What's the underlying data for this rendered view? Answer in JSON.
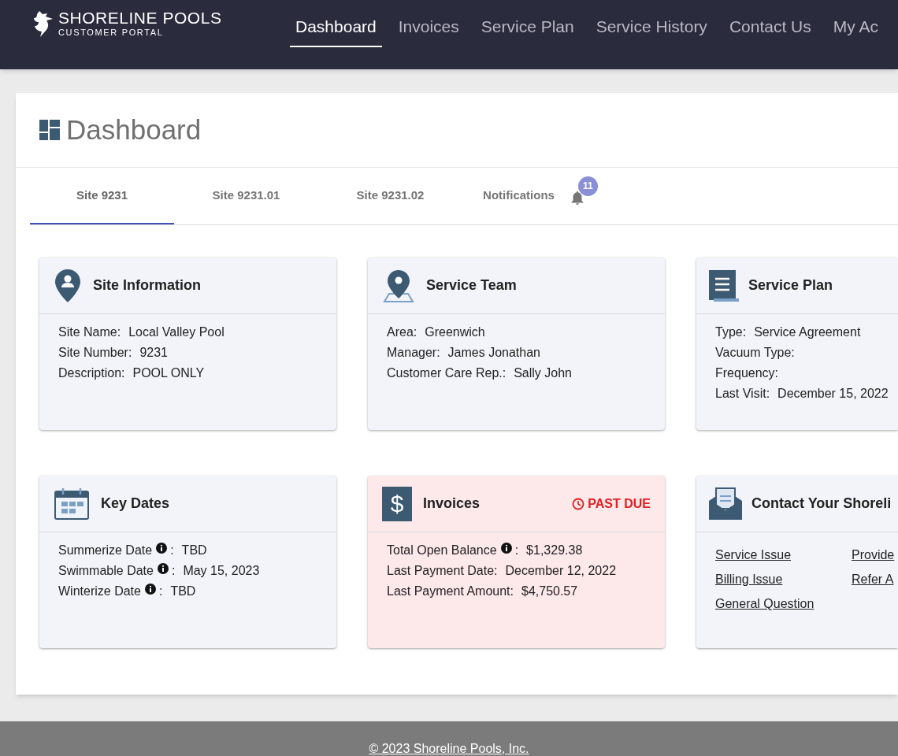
{
  "nav": {
    "logo": {
      "title": "SHORELINE POOLS",
      "subtitle": "CUSTOMER PORTAL"
    },
    "links": [
      {
        "label": "Dashboard",
        "selected": true
      },
      {
        "label": "Invoices",
        "selected": false
      },
      {
        "label": "Service Plan",
        "selected": false
      },
      {
        "label": "Service History",
        "selected": false
      },
      {
        "label": "Contact Us",
        "selected": false
      },
      {
        "label": "My Ac",
        "selected": false
      }
    ]
  },
  "page_title": "Dashboard",
  "tabs": [
    {
      "label": "Site 9231",
      "selected": true
    },
    {
      "label": "Site 9231.01",
      "selected": false
    },
    {
      "label": "Site 9231.02",
      "selected": false
    },
    {
      "label": "Notifications",
      "selected": false,
      "badge": "11"
    }
  ],
  "cards": [
    {
      "kind": "site",
      "title": "Site Information",
      "highlighted": false,
      "fields": [
        {
          "label": "Site Name:",
          "info": false,
          "value": "Local Valley Pool"
        },
        {
          "label": "Site Number:",
          "info": false,
          "value": "9231"
        },
        {
          "label": "Description:",
          "info": false,
          "value": "POOL ONLY"
        }
      ]
    },
    {
      "kind": "team",
      "title": "Service Team",
      "highlighted": false,
      "fields": [
        {
          "label": "Area:",
          "info": false,
          "value": "Greenwich"
        },
        {
          "label": "Manager:",
          "info": false,
          "value": "James Jonathan"
        },
        {
          "label": "Customer Care Rep.:",
          "info": false,
          "value": "Sally John"
        }
      ]
    },
    {
      "kind": "plan",
      "title": "Service Plan",
      "highlighted": false,
      "fields": [
        {
          "label": "Type:",
          "info": false,
          "value": "Service Agreement"
        },
        {
          "label": "Vacuum Type:",
          "info": false
        },
        {
          "label": "Frequency:",
          "info": false
        },
        {
          "label": "Last Visit:",
          "info": false,
          "value": "December 15, 2022"
        }
      ]
    },
    {
      "kind": "dates",
      "title": "Key Dates",
      "highlighted": false,
      "fields": [
        {
          "label": "Summerize Date",
          "info": true,
          "separator": ":",
          "value": "TBD"
        },
        {
          "label": "Swimmable Date",
          "info": true,
          "separator": ":",
          "value": "May 15, 2023"
        },
        {
          "label": "Winterize Date",
          "info": true,
          "separator": ":",
          "value": "TBD"
        }
      ]
    },
    {
      "kind": "invoices",
      "icon_text": "$",
      "title": "Invoices",
      "highlighted": true,
      "status": "PAST DUE",
      "fields": [
        {
          "label": "Total Open Balance",
          "info": true,
          "separator": ":",
          "value": "$1,329.38"
        },
        {
          "label": "Last Payment Date:",
          "info": false,
          "value": "December 12, 2022"
        },
        {
          "label": "Last Payment Amount:",
          "info": false,
          "value": "$4,750.57"
        }
      ]
    },
    {
      "kind": "contact",
      "title": "Contact Your Shoreli",
      "highlighted": false,
      "links": [
        "Service Issue",
        "Billing Issue",
        "General Question",
        "Provide",
        "Refer A"
      ]
    }
  ],
  "footer": "© 2023 Shoreline Pools, Inc."
}
